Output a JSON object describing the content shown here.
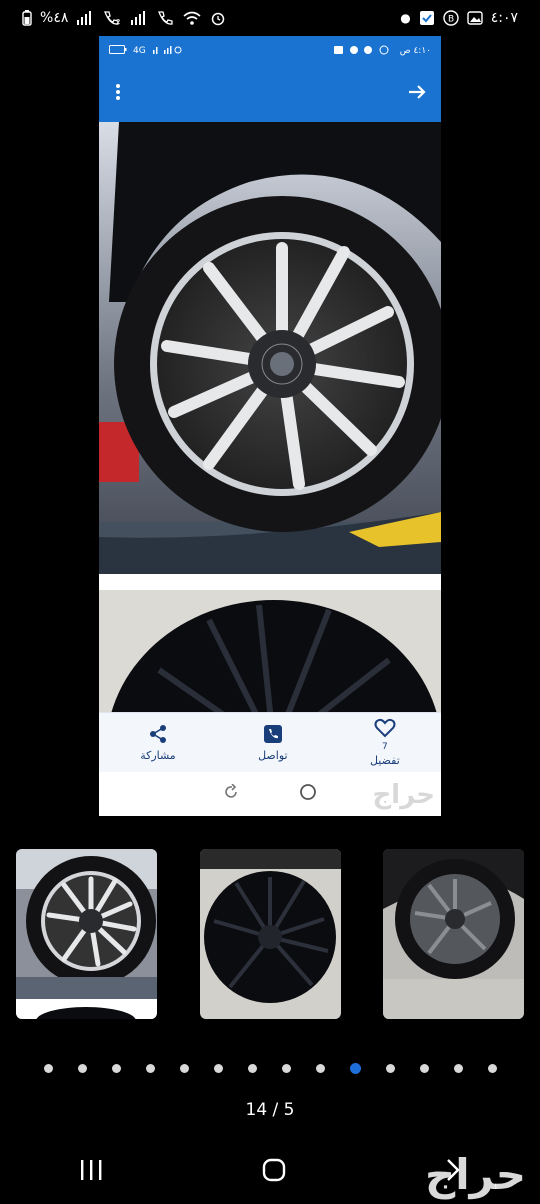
{
  "status_bar": {
    "time": "٤:٠٧",
    "battery": "%٤٨"
  },
  "inner_status": {
    "time": "٤:١٠ ص",
    "net": "4G"
  },
  "action_bar": {
    "share_label": "مشاركة",
    "contact_label": "تواصل",
    "favorite_label": "تفضيل",
    "favorite_count": "7"
  },
  "watermark": "حراج",
  "pager": {
    "total_dots": 14,
    "active_index": 9,
    "counter": "14 / 5"
  },
  "icons": [
    "overflow-icon",
    "forward-arrow-icon",
    "share-icon",
    "phone-icon",
    "heart-icon",
    "back-icon",
    "home-icon",
    "recents-icon"
  ]
}
